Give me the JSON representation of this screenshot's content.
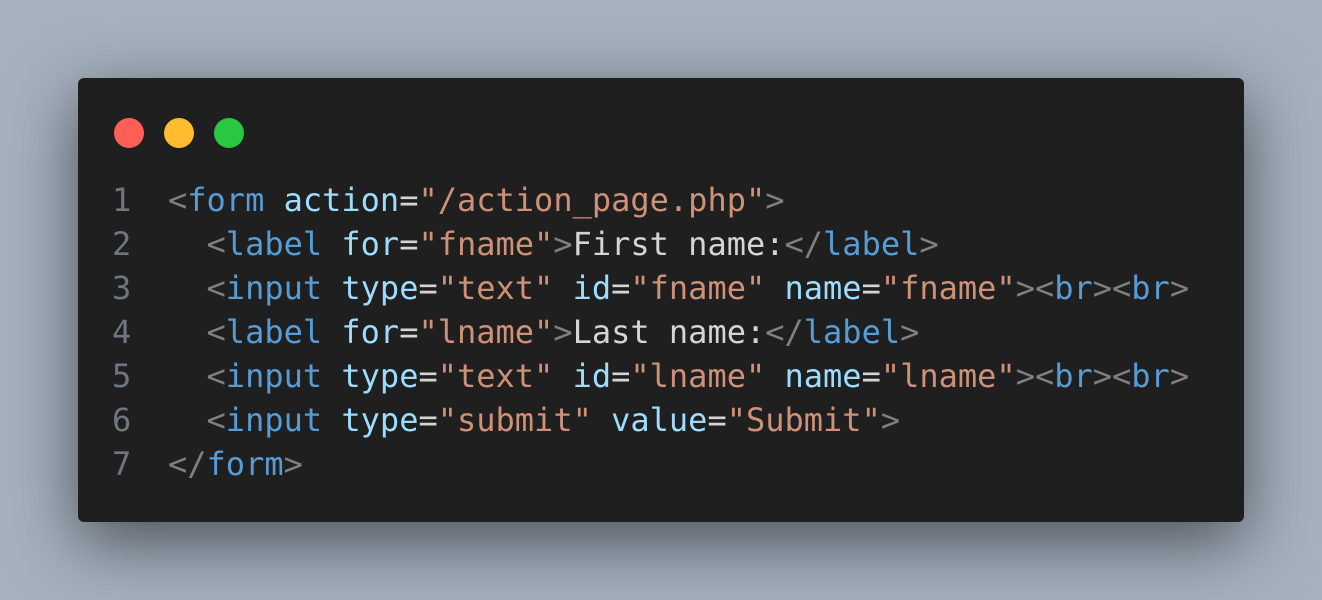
{
  "colors": {
    "background": "#a5b1be",
    "editor_background": "#1f1f1f",
    "line_number": "#6e7681",
    "bracket": "#808080",
    "tag": "#569cd6",
    "attribute": "#9cdcfe",
    "equals": "#d4d4d4",
    "string": "#ce9178",
    "text": "#d4d4d4",
    "traffic_red": "#ff5f57",
    "traffic_yellow": "#febc2e",
    "traffic_green": "#28c840"
  },
  "window_controls": [
    {
      "name": "close",
      "icon": "red-circle"
    },
    {
      "name": "minimize",
      "icon": "yellow-circle"
    },
    {
      "name": "maximize",
      "icon": "green-circle"
    }
  ],
  "code": {
    "lines": [
      {
        "number": "1",
        "tokens": [
          {
            "t": "<",
            "k": "bracket"
          },
          {
            "t": "form",
            "k": "tag"
          },
          {
            "t": " ",
            "k": "text"
          },
          {
            "t": "action",
            "k": "attribute"
          },
          {
            "t": "=",
            "k": "equals"
          },
          {
            "t": "\"/action_page.php\"",
            "k": "string"
          },
          {
            "t": ">",
            "k": "bracket"
          }
        ]
      },
      {
        "number": "2",
        "tokens": [
          {
            "t": "  ",
            "k": "text"
          },
          {
            "t": "<",
            "k": "bracket"
          },
          {
            "t": "label",
            "k": "tag"
          },
          {
            "t": " ",
            "k": "text"
          },
          {
            "t": "for",
            "k": "attribute"
          },
          {
            "t": "=",
            "k": "equals"
          },
          {
            "t": "\"fname\"",
            "k": "string"
          },
          {
            "t": ">",
            "k": "bracket"
          },
          {
            "t": "First name:",
            "k": "text"
          },
          {
            "t": "</",
            "k": "bracket"
          },
          {
            "t": "label",
            "k": "tag"
          },
          {
            "t": ">",
            "k": "bracket"
          }
        ]
      },
      {
        "number": "3",
        "tokens": [
          {
            "t": "  ",
            "k": "text"
          },
          {
            "t": "<",
            "k": "bracket"
          },
          {
            "t": "input",
            "k": "tag"
          },
          {
            "t": " ",
            "k": "text"
          },
          {
            "t": "type",
            "k": "attribute"
          },
          {
            "t": "=",
            "k": "equals"
          },
          {
            "t": "\"text\"",
            "k": "string"
          },
          {
            "t": " ",
            "k": "text"
          },
          {
            "t": "id",
            "k": "attribute"
          },
          {
            "t": "=",
            "k": "equals"
          },
          {
            "t": "\"fname\"",
            "k": "string"
          },
          {
            "t": " ",
            "k": "text"
          },
          {
            "t": "name",
            "k": "attribute"
          },
          {
            "t": "=",
            "k": "equals"
          },
          {
            "t": "\"fname\"",
            "k": "string"
          },
          {
            "t": "><",
            "k": "bracket"
          },
          {
            "t": "br",
            "k": "tag"
          },
          {
            "t": "><",
            "k": "bracket"
          },
          {
            "t": "br",
            "k": "tag"
          },
          {
            "t": ">",
            "k": "bracket"
          }
        ]
      },
      {
        "number": "4",
        "tokens": [
          {
            "t": "  ",
            "k": "text"
          },
          {
            "t": "<",
            "k": "bracket"
          },
          {
            "t": "label",
            "k": "tag"
          },
          {
            "t": " ",
            "k": "text"
          },
          {
            "t": "for",
            "k": "attribute"
          },
          {
            "t": "=",
            "k": "equals"
          },
          {
            "t": "\"lname\"",
            "k": "string"
          },
          {
            "t": ">",
            "k": "bracket"
          },
          {
            "t": "Last name:",
            "k": "text"
          },
          {
            "t": "</",
            "k": "bracket"
          },
          {
            "t": "label",
            "k": "tag"
          },
          {
            "t": ">",
            "k": "bracket"
          }
        ]
      },
      {
        "number": "5",
        "tokens": [
          {
            "t": "  ",
            "k": "text"
          },
          {
            "t": "<",
            "k": "bracket"
          },
          {
            "t": "input",
            "k": "tag"
          },
          {
            "t": " ",
            "k": "text"
          },
          {
            "t": "type",
            "k": "attribute"
          },
          {
            "t": "=",
            "k": "equals"
          },
          {
            "t": "\"text\"",
            "k": "string"
          },
          {
            "t": " ",
            "k": "text"
          },
          {
            "t": "id",
            "k": "attribute"
          },
          {
            "t": "=",
            "k": "equals"
          },
          {
            "t": "\"lname\"",
            "k": "string"
          },
          {
            "t": " ",
            "k": "text"
          },
          {
            "t": "name",
            "k": "attribute"
          },
          {
            "t": "=",
            "k": "equals"
          },
          {
            "t": "\"lname\"",
            "k": "string"
          },
          {
            "t": "><",
            "k": "bracket"
          },
          {
            "t": "br",
            "k": "tag"
          },
          {
            "t": "><",
            "k": "bracket"
          },
          {
            "t": "br",
            "k": "tag"
          },
          {
            "t": ">",
            "k": "bracket"
          }
        ]
      },
      {
        "number": "6",
        "tokens": [
          {
            "t": "  ",
            "k": "text"
          },
          {
            "t": "<",
            "k": "bracket"
          },
          {
            "t": "input",
            "k": "tag"
          },
          {
            "t": " ",
            "k": "text"
          },
          {
            "t": "type",
            "k": "attribute"
          },
          {
            "t": "=",
            "k": "equals"
          },
          {
            "t": "\"submit\"",
            "k": "string"
          },
          {
            "t": " ",
            "k": "text"
          },
          {
            "t": "value",
            "k": "attribute"
          },
          {
            "t": "=",
            "k": "equals"
          },
          {
            "t": "\"Submit\"",
            "k": "string"
          },
          {
            "t": ">",
            "k": "bracket"
          }
        ]
      },
      {
        "number": "7",
        "tokens": [
          {
            "t": "</",
            "k": "bracket"
          },
          {
            "t": "form",
            "k": "tag"
          },
          {
            "t": ">",
            "k": "bracket"
          }
        ]
      }
    ]
  }
}
